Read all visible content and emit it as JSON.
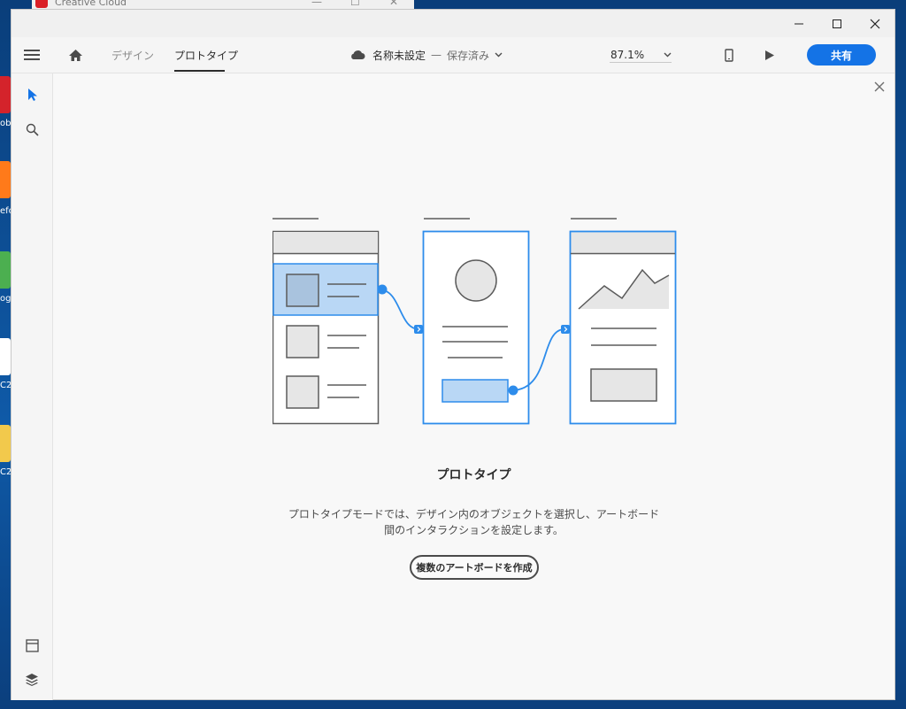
{
  "background_window": {
    "title": "Creative Cloud"
  },
  "desktop": {
    "icons": [
      {
        "name": "adobe-icon",
        "label": "ob",
        "color": "#d4232b"
      },
      {
        "name": "firefox-icon",
        "label": "efo",
        "color": "#ff7a1a"
      },
      {
        "name": "chrome-icon",
        "label": "og",
        "color": "#4caf50"
      },
      {
        "name": "app-q-icon",
        "label": "C2",
        "color": "#ffffff"
      },
      {
        "name": "app-folder-icon",
        "label": "C2",
        "color": "#f2c94c"
      }
    ]
  },
  "window": {
    "controls": {
      "minimize": "minimize-icon",
      "maximize": "maximize-icon",
      "close": "close-icon"
    }
  },
  "toolbar": {
    "tabs": [
      {
        "label": "デザイン",
        "active": false
      },
      {
        "label": "プロトタイプ",
        "active": true
      }
    ],
    "document": {
      "title": "名称未設定",
      "separator": "—",
      "status": "保存済み"
    },
    "zoom": "87.1%",
    "share_label": "共有"
  },
  "canvas": {
    "heading": "プロトタイプ",
    "description": [
      "プロトタイプモードでは、デザイン内のオブジェクトを選択し、アートボード",
      "間のインタラクションを設定します。"
    ],
    "create_button": "複数のアートボードを作成"
  },
  "colors": {
    "accent": "#1473e6",
    "illustration_blue": "#2d8ceb",
    "illustration_fill": "#b9d7f5",
    "illustration_gray": "#e6e6e6"
  }
}
